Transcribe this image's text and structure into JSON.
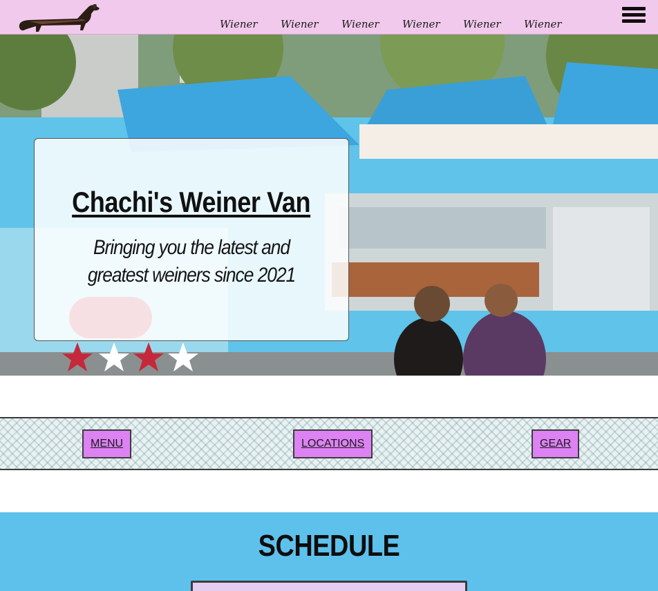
{
  "header": {
    "logo_icon": "dachshund-logo-icon",
    "nav": [
      {
        "label": "Wiener"
      },
      {
        "label": "Wiener"
      },
      {
        "label": "Wiener"
      },
      {
        "label": "Wiener"
      },
      {
        "label": "Wiener"
      },
      {
        "label": "Wiener"
      }
    ],
    "menu_icon": "hamburger-menu-icon"
  },
  "hero": {
    "title": "Chachi's Weiner Van",
    "subtitle": "Bringing you the latest and greatest weiners since 2021"
  },
  "links": {
    "menu": "MENU",
    "locations": "LOCATIONS",
    "gear": "GEAR"
  },
  "schedule": {
    "title": "SCHEDULE"
  },
  "colors": {
    "header_bg": "#f1c9ec",
    "button_bg": "#dd82f3",
    "schedule_bg": "#5ec1ec",
    "truck_blue": "#5fc3ea"
  }
}
